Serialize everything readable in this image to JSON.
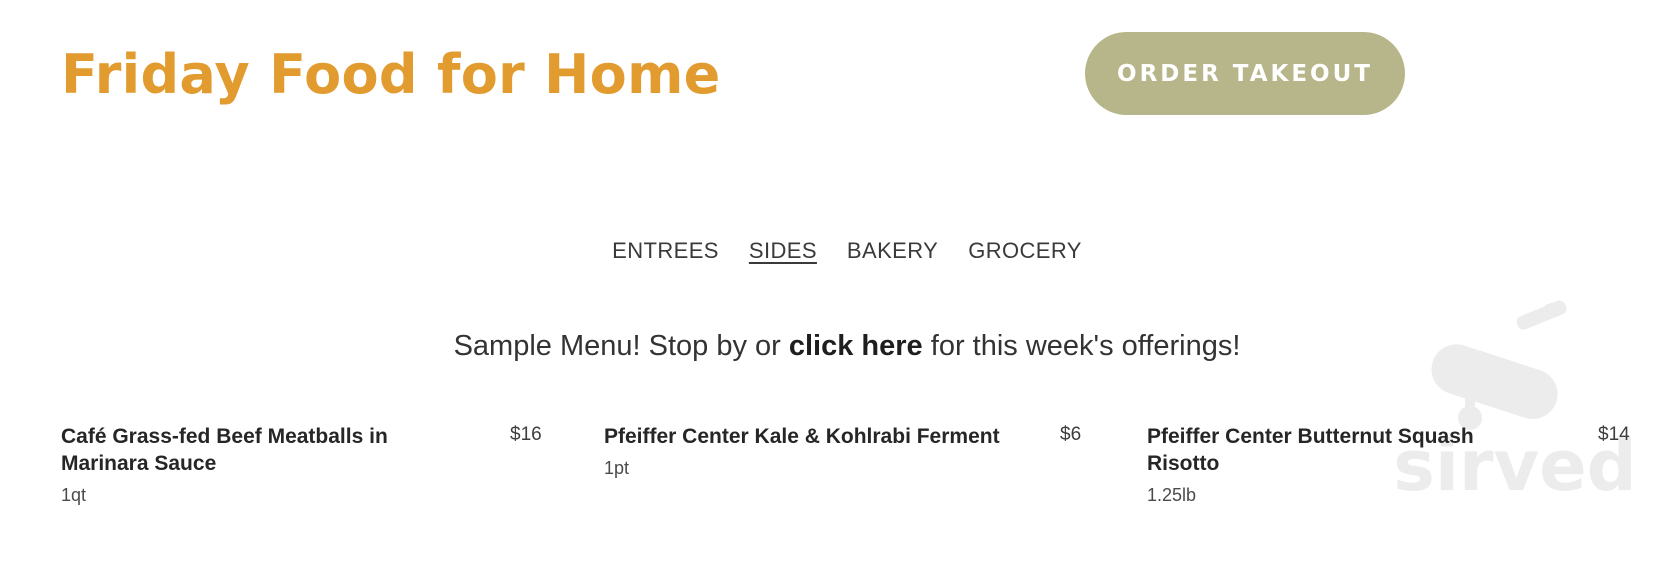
{
  "header": {
    "title": "Friday Food for Home",
    "order_button": "ORDER TAKEOUT"
  },
  "tabs": [
    {
      "label": "ENTREES",
      "active": false
    },
    {
      "label": "SIDES",
      "active": true
    },
    {
      "label": "BAKERY",
      "active": false
    },
    {
      "label": "GROCERY",
      "active": false
    }
  ],
  "notice": {
    "before": "Sample Menu! Stop by or ",
    "link": "click here",
    "after": " for this week's offerings!"
  },
  "menu_items": [
    {
      "name": "Café Grass-fed Beef Meatballs in Marinara Sauce",
      "size": "1qt",
      "price": "$16"
    },
    {
      "name": "Pfeiffer Center Kale & Kohlrabi Ferment",
      "size": "1pt",
      "price": "$6"
    },
    {
      "name": "Pfeiffer Center Butternut Squash Risotto",
      "size": "1.25lb",
      "price": "$14"
    }
  ],
  "watermark": {
    "text": "sirved",
    "icon": "utensil-knife-icon"
  },
  "colors": {
    "title": "#e29b2e",
    "button_bg": "#b7b68a",
    "button_text": "#ffffff",
    "watermark": "#e6e6e6"
  }
}
